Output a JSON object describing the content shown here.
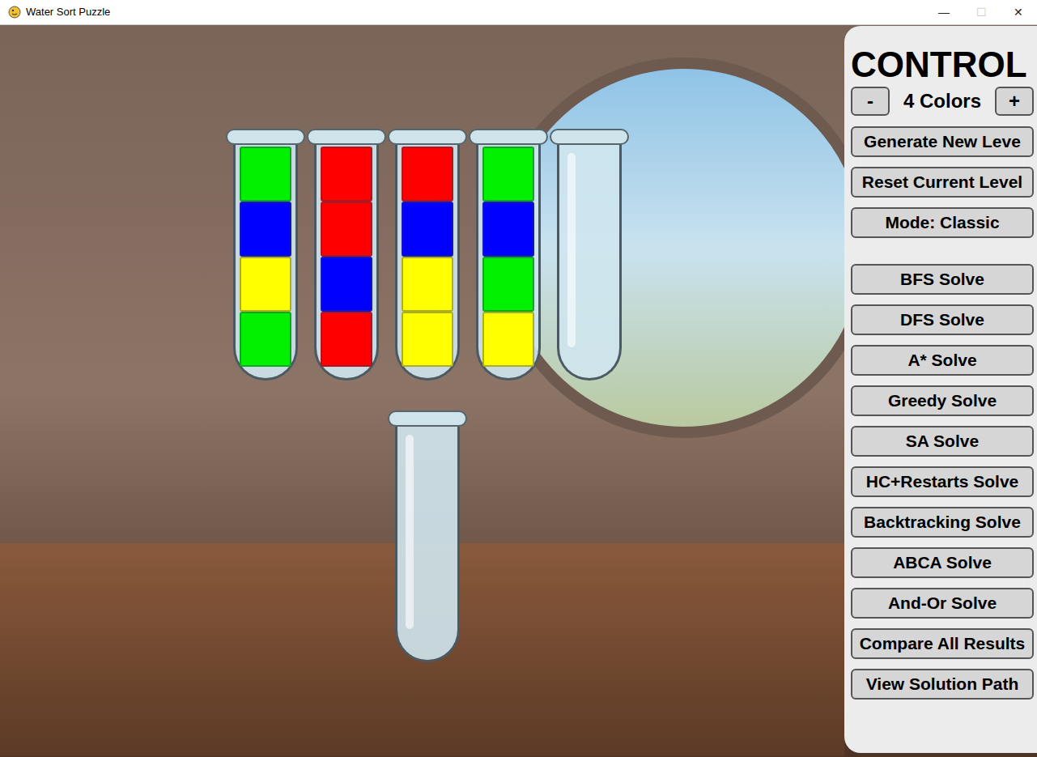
{
  "window": {
    "title": "Water Sort Puzzle",
    "controls": [
      {
        "glyph": "—",
        "disabled": false
      },
      {
        "glyph": "☐",
        "disabled": true
      },
      {
        "glyph": "✕",
        "disabled": false
      }
    ]
  },
  "board": {
    "tube_rows": [
      {
        "tubes": [
          {
            "layers": [
              {
                "color": "#00f000"
              },
              {
                "color": "#0000ff"
              },
              {
                "color": "#ffff00"
              },
              {
                "color": "#00f000"
              }
            ]
          },
          {
            "layers": [
              {
                "color": "#ff0000"
              },
              {
                "color": "#ff0000"
              },
              {
                "color": "#0000ff"
              },
              {
                "color": "#ff0000"
              }
            ]
          },
          {
            "layers": [
              {
                "color": "#ff0000"
              },
              {
                "color": "#0000ff"
              },
              {
                "color": "#ffff00"
              },
              {
                "color": "#ffff00"
              }
            ]
          },
          {
            "layers": [
              {
                "color": "#00f000"
              },
              {
                "color": "#0000ff"
              },
              {
                "color": "#00f000"
              },
              {
                "color": "#ffff00"
              }
            ]
          },
          {
            "layers": []
          }
        ]
      },
      {
        "tubes": [
          {
            "layers": []
          }
        ]
      }
    ]
  },
  "control": {
    "title": "CONTROL",
    "colors": {
      "minus": "-",
      "label": "4 Colors",
      "plus": "+"
    },
    "level_buttons": [
      {
        "label": "Generate New Leve",
        "disabled": false
      },
      {
        "label": "Reset Current Level",
        "disabled": false
      },
      {
        "label": "Mode: Classic",
        "disabled": false
      }
    ],
    "solver_buttons": [
      {
        "label": "BFS Solve",
        "disabled": false
      },
      {
        "label": "DFS Solve",
        "disabled": false
      },
      {
        "label": "A* Solve",
        "disabled": false
      },
      {
        "label": "Greedy Solve",
        "disabled": false
      },
      {
        "label": "SA Solve",
        "disabled": false
      },
      {
        "label": "HC+Restarts Solve",
        "disabled": false
      },
      {
        "label": "Backtracking Solve",
        "disabled": false
      },
      {
        "label": "ABCA Solve",
        "disabled": false
      },
      {
        "label": "And-Or Solve",
        "disabled": false
      },
      {
        "label": "Compare All Results",
        "disabled": false
      },
      {
        "label": "View Solution Path",
        "disabled": true
      }
    ]
  }
}
